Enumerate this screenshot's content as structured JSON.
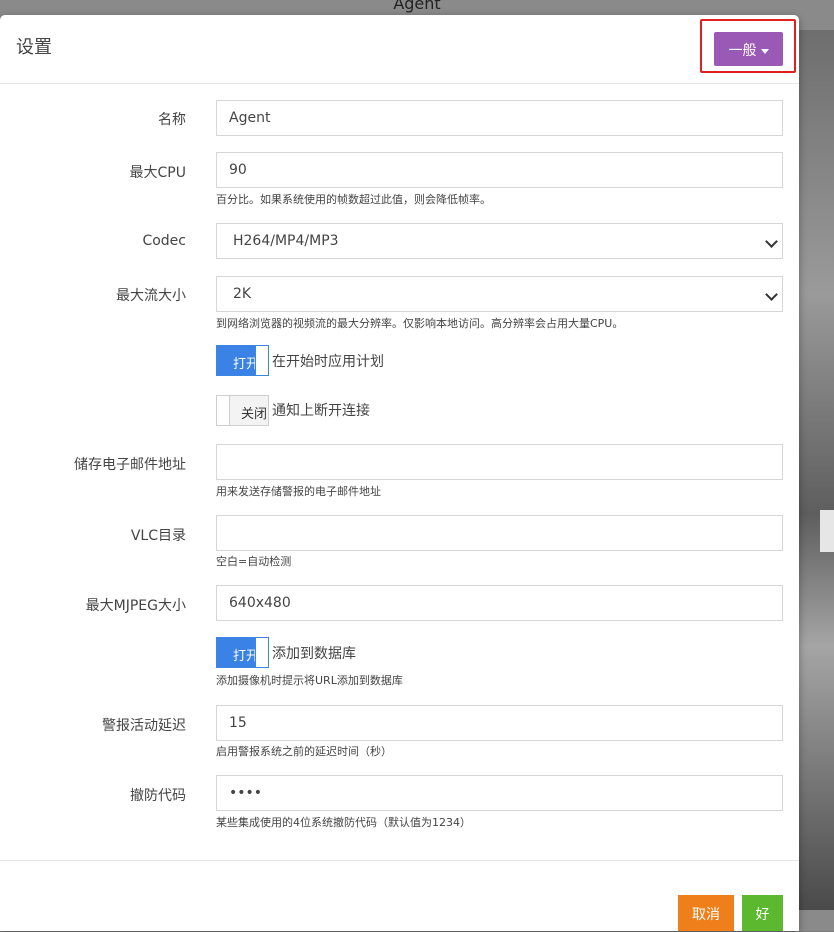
{
  "background": {
    "window_title": "Agent"
  },
  "modal": {
    "title": "设置",
    "mode_button": "一般"
  },
  "fields": {
    "name": {
      "label": "名称",
      "value": "Agent"
    },
    "max_cpu": {
      "label": "最大CPU",
      "value": "90",
      "help": "百分比。如果系统使用的帧数超过此值，则会降低帧率。"
    },
    "codec": {
      "label": "Codec",
      "value": "H264/MP4/MP3"
    },
    "max_stream": {
      "label": "最大流大小",
      "value": "2K",
      "help": "到网络浏览器的视频流的最大分辨率。仅影响本地访问。高分辨率会占用大量CPU。"
    },
    "apply_schedule": {
      "state": "打开",
      "label": "在开始时应用计划"
    },
    "notify_disconnect": {
      "state": "关闭",
      "label": "通知上断开连接"
    },
    "storage_email": {
      "label": "储存电子邮件地址",
      "value": "",
      "help": "用来发送存储警报的电子邮件地址"
    },
    "vlc_dir": {
      "label": "VLC目录",
      "value": "",
      "help": "空白=自动检测"
    },
    "max_mjpeg": {
      "label": "最大MJPEG大小",
      "value": "640x480"
    },
    "add_to_db": {
      "state": "打开",
      "label": "添加到数据库",
      "help": "添加摄像机时提示将URL添加到数据库"
    },
    "alert_delay": {
      "label": "警报活动延迟",
      "value": "15",
      "help": "启用警报系统之前的延迟时间（秒）"
    },
    "disarm_code": {
      "label": "撤防代码",
      "value": "••••",
      "help": "某些集成使用的4位系统撤防代码（默认值为1234）"
    }
  },
  "footer": {
    "cancel": "取消",
    "ok": "好"
  },
  "colors": {
    "accent": "#9b59b6",
    "toggle_on": "#3b82e6",
    "cancel": "#ef7f1a",
    "ok": "#5cb82e",
    "highlight": "#e02020"
  }
}
